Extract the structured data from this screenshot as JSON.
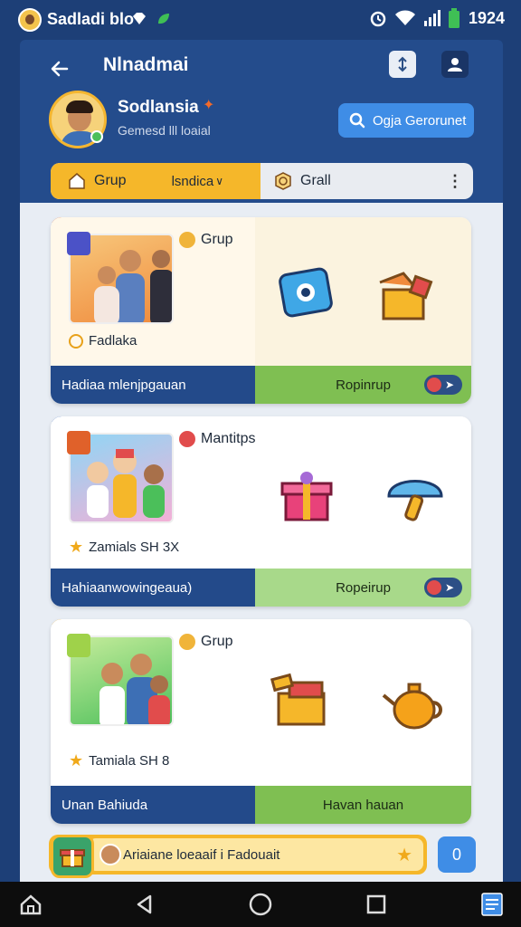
{
  "status_bar": {
    "app_name": "Sadladi blo",
    "time": "1924"
  },
  "header": {
    "title": "Nlnadmai",
    "user_name": "Sodlansia",
    "user_subtitle": "Gemesd lll loaial",
    "search_button": "Ogja Gerorunet"
  },
  "tabs": {
    "active_label": "Grup",
    "active_dropdown": "lsndica",
    "second_label": "Grall"
  },
  "cards": [
    {
      "tag": "Grup",
      "subline": "Fadlaka",
      "footer_left": "Hadiaa mlenjpgauan",
      "footer_right": "Ropinrup",
      "accent": "#e0612a"
    },
    {
      "tag": "Mantitps",
      "subline": "Zamials SH 3X",
      "footer_left": "Hahiaanwowingeaua)",
      "footer_right": "Ropeirup",
      "accent": "#2b66c7"
    },
    {
      "tag": "Grup",
      "subline": "Tamiala SH 8",
      "footer_left": "Unan Bahiuda",
      "footer_right": "Havan hauan",
      "accent": "#f0a91a"
    }
  ],
  "promo": {
    "text": "Ariaiane loeaaif i Fadouait",
    "button": "0"
  },
  "colors": {
    "navy": "#1d3f77",
    "accent_blue": "#3f8de6",
    "accent_yellow": "#f5b72a",
    "accent_green": "#7fbf52"
  }
}
